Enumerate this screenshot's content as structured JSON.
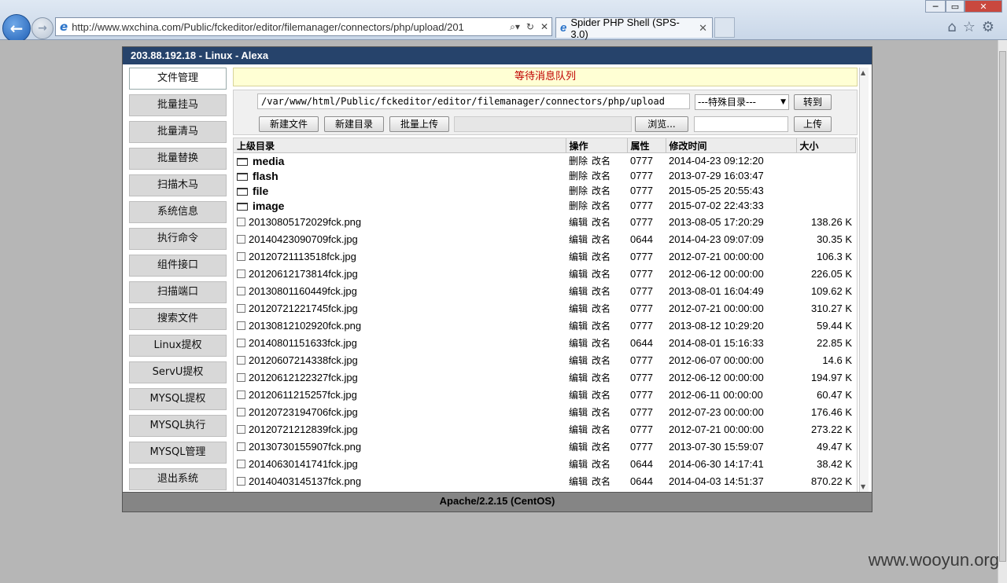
{
  "browser": {
    "address": "http://www.wxchina.com/Public/fckeditor/editor/filemanager/connectors/php/upload/201",
    "tab_title": "Spider PHP Shell (SPS-3.0)",
    "tab_close": "✕"
  },
  "shell": {
    "header": "203.88.192.18 - Linux - Alexa",
    "footer": "Apache/2.2.15 (CentOS)",
    "message": "等待消息队列"
  },
  "sidebar": {
    "items": [
      {
        "label": "文件管理"
      },
      {
        "label": "批量挂马"
      },
      {
        "label": "批量清马"
      },
      {
        "label": "批量替换"
      },
      {
        "label": "扫描木马"
      },
      {
        "label": "系统信息"
      },
      {
        "label": "执行命令"
      },
      {
        "label": "组件接口"
      },
      {
        "label": "扫描端口"
      },
      {
        "label": "搜索文件"
      },
      {
        "label": "Linux提权"
      },
      {
        "label": "ServU提权"
      },
      {
        "label": "MYSQL提权"
      },
      {
        "label": "MYSQL执行"
      },
      {
        "label": "MYSQL管理"
      },
      {
        "label": "退出系统"
      }
    ]
  },
  "toolbar": {
    "path_value": "/var/www/html/Public/fckeditor/editor/filemanager/connectors/php/upload",
    "special_dir": "---特殊目录---",
    "go_label": "转到",
    "new_file": "新建文件",
    "new_dir": "新建目录",
    "batch_upload": "批量上传",
    "browse": "浏览...",
    "upload": "上传"
  },
  "table": {
    "headers": {
      "name": "上级目录",
      "ops": "操作",
      "perm": "属性",
      "mtime": "修改时间",
      "size": "大小"
    },
    "dir_ops": {
      "del": "删除",
      "rename": "改名"
    },
    "file_ops": {
      "edit": "编辑",
      "rename": "改名"
    },
    "dirs": [
      {
        "name": "media",
        "perm": "0777",
        "mtime": "2014-04-23 09:12:20"
      },
      {
        "name": "flash",
        "perm": "0777",
        "mtime": "2013-07-29 16:03:47"
      },
      {
        "name": "file",
        "perm": "0777",
        "mtime": "2015-05-25 20:55:43"
      },
      {
        "name": "image",
        "perm": "0777",
        "mtime": "2015-07-02 22:43:33"
      }
    ],
    "files": [
      {
        "name": "20130805172029fck.png",
        "perm": "0777",
        "mtime": "2013-08-05 17:20:29",
        "size": "138.26 K"
      },
      {
        "name": "20140423090709fck.jpg",
        "perm": "0644",
        "mtime": "2014-04-23 09:07:09",
        "size": "30.35 K"
      },
      {
        "name": "20120721113518fck.jpg",
        "perm": "0777",
        "mtime": "2012-07-21 00:00:00",
        "size": "106.3 K"
      },
      {
        "name": "20120612173814fck.jpg",
        "perm": "0777",
        "mtime": "2012-06-12 00:00:00",
        "size": "226.05 K"
      },
      {
        "name": "20130801160449fck.jpg",
        "perm": "0777",
        "mtime": "2013-08-01 16:04:49",
        "size": "109.62 K"
      },
      {
        "name": "20120721221745fck.jpg",
        "perm": "0777",
        "mtime": "2012-07-21 00:00:00",
        "size": "310.27 K"
      },
      {
        "name": "20130812102920fck.png",
        "perm": "0777",
        "mtime": "2013-08-12 10:29:20",
        "size": "59.44 K"
      },
      {
        "name": "20140801151633fck.jpg",
        "perm": "0644",
        "mtime": "2014-08-01 15:16:33",
        "size": "22.85 K"
      },
      {
        "name": "20120607214338fck.jpg",
        "perm": "0777",
        "mtime": "2012-06-07 00:00:00",
        "size": "14.6 K"
      },
      {
        "name": "20120612122327fck.jpg",
        "perm": "0777",
        "mtime": "2012-06-12 00:00:00",
        "size": "194.97 K"
      },
      {
        "name": "20120611215257fck.jpg",
        "perm": "0777",
        "mtime": "2012-06-11 00:00:00",
        "size": "60.47 K"
      },
      {
        "name": "20120723194706fck.jpg",
        "perm": "0777",
        "mtime": "2012-07-23 00:00:00",
        "size": "176.46 K"
      },
      {
        "name": "20120721212839fck.jpg",
        "perm": "0777",
        "mtime": "2012-07-21 00:00:00",
        "size": "273.22 K"
      },
      {
        "name": "20130730155907fck.png",
        "perm": "0777",
        "mtime": "2013-07-30 15:59:07",
        "size": "49.47 K"
      },
      {
        "name": "20140630141741fck.jpg",
        "perm": "0644",
        "mtime": "2014-06-30 14:17:41",
        "size": "38.42 K"
      },
      {
        "name": "20140403145137fck.png",
        "perm": "0644",
        "mtime": "2014-04-03 14:51:37",
        "size": "870.22 K"
      }
    ]
  },
  "watermark": "www.wooyun.org",
  "colors": {
    "header_bg": "#26436b",
    "footer_bg": "#858585",
    "message_text": "#c00000",
    "message_bg": "#ffffd4"
  },
  "icons": [
    "back-arrow-icon",
    "forward-arrow-icon",
    "ie-icon",
    "search-icon",
    "refresh-icon",
    "stop-icon",
    "home-icon",
    "star-icon",
    "gear-icon",
    "folder-icon",
    "checkbox-icon"
  ]
}
